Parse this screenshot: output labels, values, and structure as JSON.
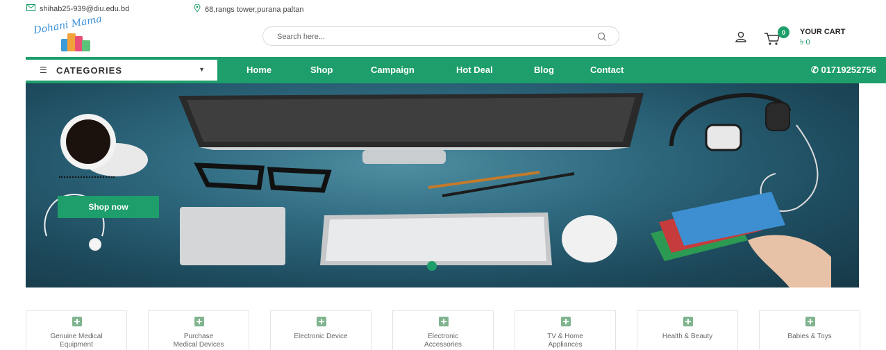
{
  "topbar": {
    "email": "shihab25-939@diu.edu.bd",
    "address": "68,rangs tower,purana paltan"
  },
  "header": {
    "logo_text": "Dohani Mama",
    "search_placeholder": "Search here...",
    "cart_count": "0",
    "cart_title": "YOUR CART",
    "cart_amount": "৳ 0"
  },
  "nav": {
    "categories_label": "CATEGORIES",
    "links": [
      "Home",
      "Shop",
      "Campaign",
      "Hot Deal",
      "Blog",
      "Contact"
    ],
    "phone": "01719252756"
  },
  "hero": {
    "button_label": "Shop now"
  },
  "categories": [
    "Genuine Medical\nEquipment",
    "Purchase\nMedical Devices",
    "Electronic Device",
    "Electronic\nAccessories",
    "TV & Home\nAppliances",
    "Health & Beauty",
    "Babies & Toys"
  ],
  "colors": {
    "accent": "#1e9e6a",
    "hero_bg": "#2f6a80"
  },
  "icons": [
    "mail-icon",
    "location-icon",
    "search-icon",
    "user-icon",
    "cart-icon",
    "phone-icon",
    "medical-kit-icon",
    "menu-icon",
    "caret-down-icon"
  ]
}
